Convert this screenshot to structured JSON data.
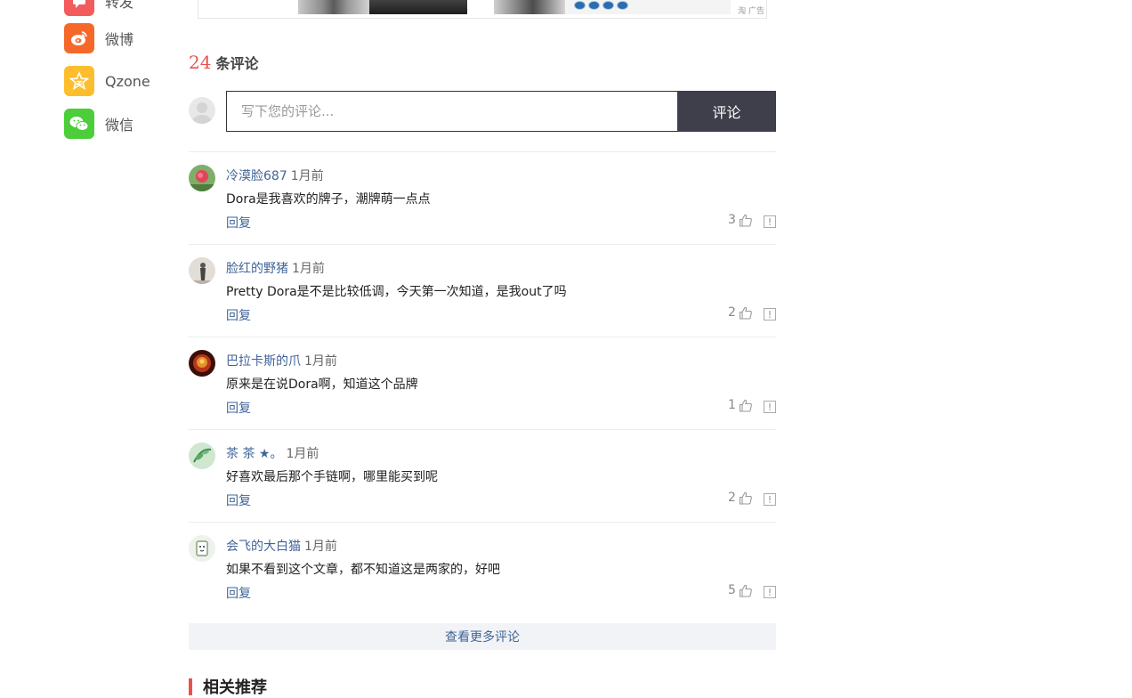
{
  "share": {
    "items": [
      {
        "label": "转发",
        "icon": "repost-icon",
        "color": "#f25c5c"
      },
      {
        "label": "微博",
        "icon": "weibo-icon",
        "color": "#f5682a"
      },
      {
        "label": "Qzone",
        "icon": "qzone-star-icon",
        "color": "#fdbe2d"
      },
      {
        "label": "微信",
        "icon": "wechat-icon",
        "color": "#4bce39"
      }
    ]
  },
  "ad": {
    "label": "淘 广告"
  },
  "comments": {
    "count": "24",
    "title": "条评论",
    "input_placeholder": "写下您的评论...",
    "submit_label": "评论",
    "reply_label": "回复",
    "items": [
      {
        "user": "冷漠脸687",
        "time": "1月前",
        "text": "Dora是我喜欢的牌子，潮牌萌一点点",
        "likes": "3"
      },
      {
        "user": "脸红的野猪",
        "time": "1月前",
        "text": "Pretty Dora是不是比较低调，今天第一次知道，是我out了吗",
        "likes": "2"
      },
      {
        "user": "巴拉卡斯的爪",
        "time": "1月前",
        "text": "原来是在说Dora啊，知道这个品牌",
        "likes": "1"
      },
      {
        "user": "茶 茶 ★。",
        "time": "1月前",
        "text": "好喜欢最后那个手链啊，哪里能买到呢",
        "likes": "2"
      },
      {
        "user": "会飞的大白猫",
        "time": "1月前",
        "text": "如果不看到这个文章，都不知道这是两家的，好吧",
        "likes": "5"
      }
    ],
    "more_label": "查看更多评论"
  },
  "related": {
    "title": "相关推荐"
  },
  "colors": {
    "accent_red": "#e9524a",
    "link_blue": "#406599",
    "button_dark": "#3e3f4b"
  }
}
